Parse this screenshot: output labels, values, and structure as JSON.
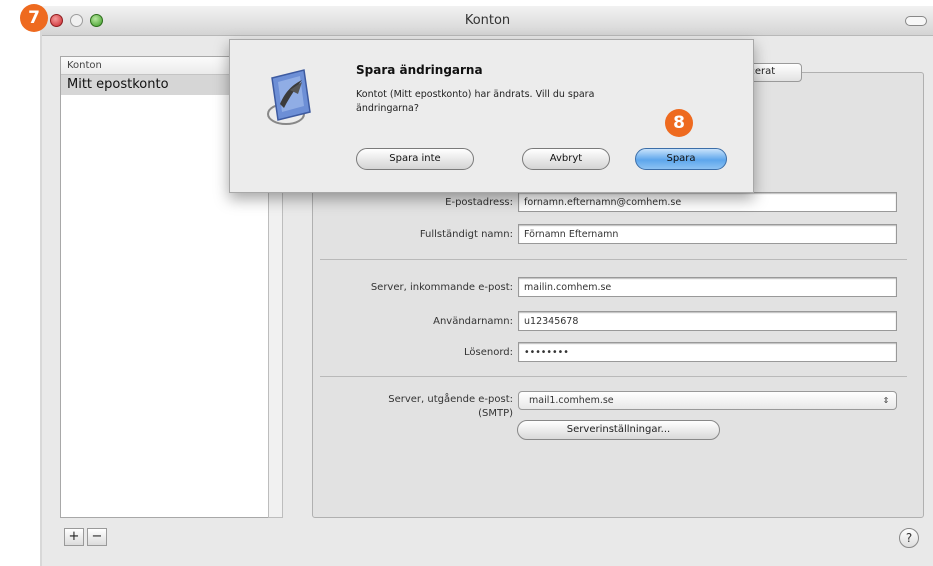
{
  "badges": {
    "step7": "7",
    "step8": "8"
  },
  "window": {
    "title": "Konton"
  },
  "accounts_list": {
    "header": "Konton",
    "items": [
      "Mitt epostkonto"
    ],
    "add_label": "+",
    "remove_label": "−"
  },
  "tab": {
    "label": "ncerat"
  },
  "form": {
    "email_label": "E-postadress:",
    "email_value": "fornamn.efternamn@comhem.se",
    "fullname_label": "Fullständigt namn:",
    "fullname_value": "Förnamn Efternamn",
    "incoming_label": "Server, inkommande e-post:",
    "incoming_value": "mailin.comhem.se",
    "username_label": "Användarnamn:",
    "username_value": "u12345678",
    "password_label": "Lösenord:",
    "password_value": "••••••••",
    "outgoing_label": "Server, utgående e-post:",
    "outgoing_sub": "(SMTP)",
    "outgoing_value": "mail1.comhem.se",
    "server_settings_label": "Serverinställningar..."
  },
  "help_label": "?",
  "dialog": {
    "title": "Spara ändringarna",
    "message": "Kontot (Mitt epostkonto) har ändrats. Vill du spara ändringarna?",
    "dont_save_label": "Spara inte",
    "cancel_label": "Avbryt",
    "save_label": "Spara"
  },
  "colors": {
    "badge": "#ee6a1f",
    "primary_button": "#5da6ec"
  }
}
